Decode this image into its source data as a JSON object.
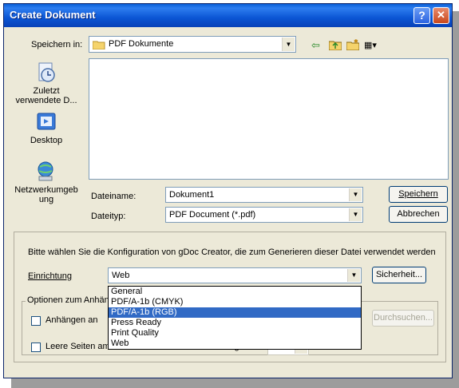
{
  "window": {
    "title": "Create Dokument"
  },
  "titlebar": {
    "help_glyph": "?",
    "close_glyph": "✕"
  },
  "save_in": {
    "label": "Speichern in:",
    "value": "PDF Dokumente"
  },
  "places": [
    {
      "label": "Zuletzt verwendete D...",
      "icon": "recent-documents-icon"
    },
    {
      "label": "Desktop",
      "icon": "desktop-icon"
    },
    {
      "label": "Netzwerkumgeb ung",
      "icon": "network-icon"
    }
  ],
  "filename": {
    "label": "Dateiname:",
    "value": "Dokument1"
  },
  "filetype": {
    "label": "Dateityp:",
    "value": "PDF Document (*.pdf)"
  },
  "buttons": {
    "save": "Speichern",
    "cancel": "Abbrechen",
    "security": "Sicherheit...",
    "browse": "Durchsuchen..."
  },
  "config": {
    "description": "Bitte wählen Sie die Konfiguration von gDoc Creator, die zum Generieren dieser Datei verwendet werden",
    "label": "Einrichtung",
    "value": "Web",
    "options": [
      "General",
      "PDF/A-1b (CMYK)",
      "PDF/A-1b (RGB)",
      "Press Ready",
      "Print Quality",
      "Web"
    ],
    "highlighted": "PDF/A-1b (RGB)"
  },
  "options_group": {
    "legend": "Optionen zum Anhän",
    "append_label": "Anhängen an",
    "blank_pages_label": "Leere Seiten am Ende dieses Dokuments anhängen"
  },
  "colors": {
    "titlebar": "#0b55d4",
    "dialog_bg": "#ece9d8",
    "selection": "#316ac5"
  }
}
